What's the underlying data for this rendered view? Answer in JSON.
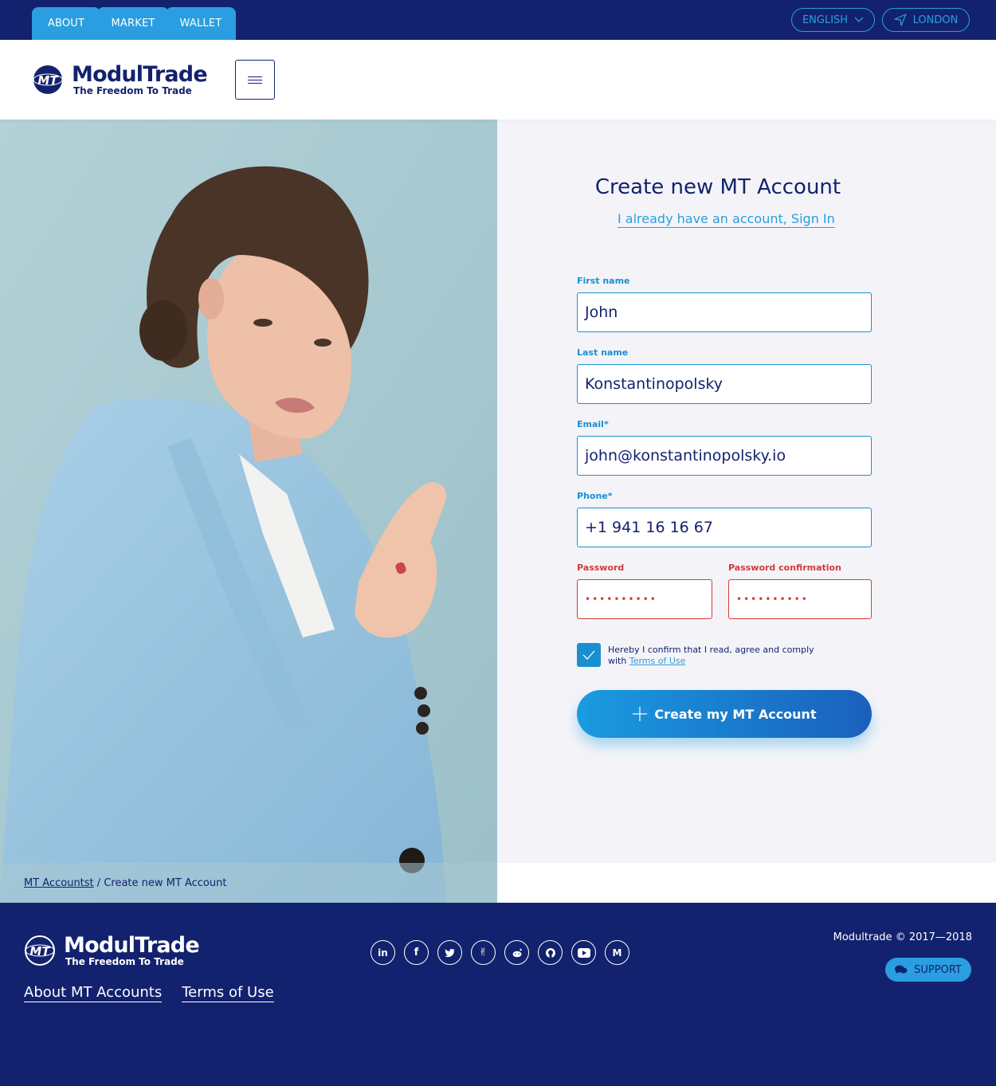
{
  "topbar": {
    "tabs": [
      {
        "label": "ABOUT"
      },
      {
        "label": "MARKET"
      },
      {
        "label": "WALLET"
      }
    ],
    "language": "ENGLISH",
    "location": "LONDON"
  },
  "header": {
    "brand": "ModulTrade",
    "tagline": "The Freedom To Trade"
  },
  "form": {
    "title": "Create new MT Account",
    "signin_link": "I already have an account, Sign In",
    "first_name": {
      "label": "First name",
      "value": "John"
    },
    "last_name": {
      "label": "Last name",
      "value": "Konstantinopolsky"
    },
    "email": {
      "label": "Email*",
      "value": "john@konstantinopolsky.io"
    },
    "phone": {
      "label": "Phone*",
      "value": "+1 941 16 16 67"
    },
    "password": {
      "label": "Password",
      "value": "••••••••••"
    },
    "password_confirmation": {
      "label": "Password confirmation",
      "value": "••••••••••"
    },
    "terms_text": "Hereby I confirm that I read, agree and comply with",
    "terms_link": "Terms of Use",
    "terms_checked": true,
    "submit_label": "Create my MT Account"
  },
  "breadcrumb": {
    "parent": "MT Accountst",
    "separator": "/",
    "current": "Create new MT Account"
  },
  "footer": {
    "brand": "ModulTrade",
    "tagline": "The Freedom To Trade",
    "links": [
      {
        "label": "About MT Accounts"
      },
      {
        "label": "Terms of Use"
      }
    ],
    "socials": [
      "linkedin-icon",
      "facebook-icon",
      "twitter-icon",
      "angellist-icon",
      "reddit-icon",
      "github-icon",
      "youtube-icon",
      "medium-icon"
    ],
    "copyright": "Modultrade © 2017—2018",
    "support_label": "SUPPORT"
  },
  "colors": {
    "navy": "#13226e",
    "accent": "#2a9ee0",
    "error": "#d33a3a",
    "panel": "#f4f4f8"
  }
}
